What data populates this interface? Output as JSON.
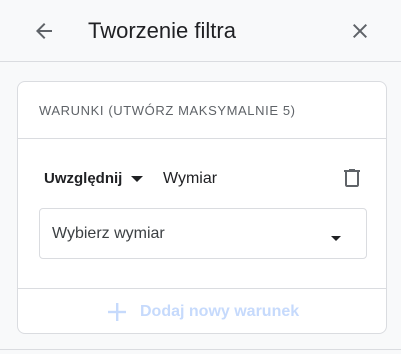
{
  "header": {
    "title": "Tworzenie filtra",
    "back_icon": "arrow-back-icon",
    "close_icon": "close-icon"
  },
  "conditions": {
    "title": "WARUNKI (UTWÓRZ MAKSYMALNIE 5)",
    "include_label": "Uwzględnij",
    "dimension_label": "Wymiar",
    "select_placeholder": "Wybierz wymiar",
    "delete_icon": "trash-icon",
    "add_condition_label": "Dodaj nowy warunek"
  },
  "colors": {
    "text": "#202124",
    "muted": "#5f6368",
    "border": "#dadce0",
    "disabled_blue": "#c6dafc"
  }
}
